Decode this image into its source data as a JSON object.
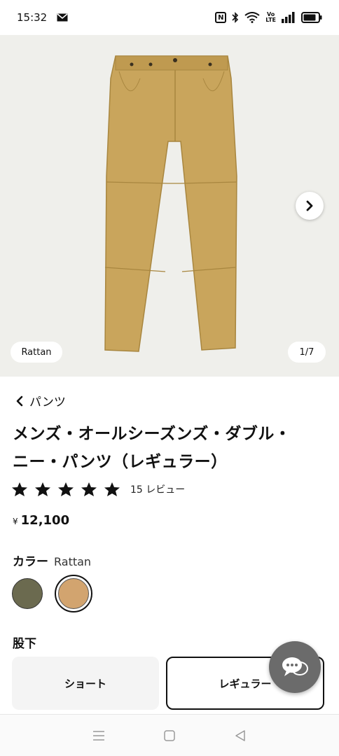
{
  "status_bar": {
    "time": "15:32",
    "icons": [
      "mail-icon",
      "nfc-icon",
      "bluetooth-icon",
      "wifi-icon",
      "volte-icon",
      "signal-icon",
      "battery-icon"
    ],
    "volte_text_1": "Vo",
    "volte_text_2": "LTE",
    "nfc_text": "N"
  },
  "gallery": {
    "color_tag": "Rattan",
    "counter": "1/7",
    "background": "#efefeb",
    "product_color": "#c9a55c"
  },
  "breadcrumb": {
    "label": "パンツ"
  },
  "product": {
    "title": "メンズ・オールシーズンズ・ダブル・ニー・パンツ（レギュラー）",
    "rating_stars": 5,
    "review_count": "15 レビュー",
    "price_symbol": "¥",
    "price": "12,100"
  },
  "color_section": {
    "label": "カラー",
    "selected": "Rattan",
    "swatches": [
      {
        "name": "olive",
        "color": "#6b6a4f",
        "selected": false
      },
      {
        "name": "rattan",
        "color": "#d2a46f",
        "selected": true
      }
    ]
  },
  "inseam_section": {
    "label": "股下",
    "options": [
      {
        "label": "ショート",
        "selected": false
      },
      {
        "label": "レギュラー",
        "selected": true
      }
    ]
  },
  "nav_bar": {
    "icons": [
      "menu-icon",
      "home-square-icon",
      "back-triangle-icon"
    ]
  }
}
